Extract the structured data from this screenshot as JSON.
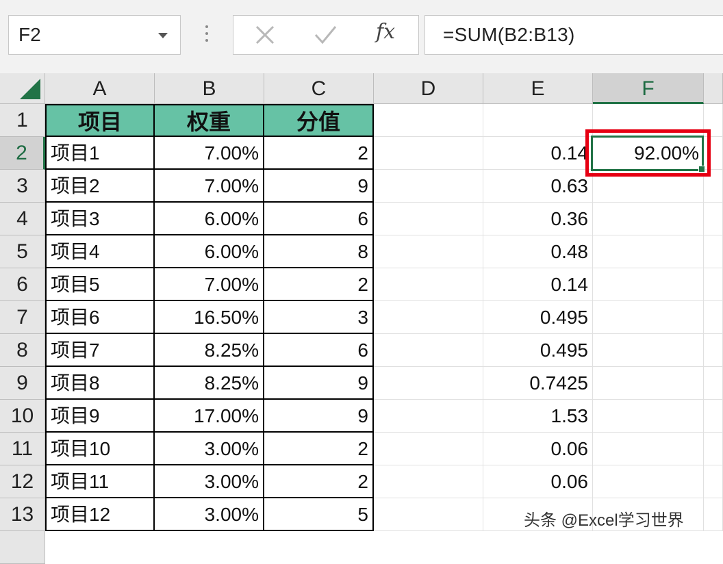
{
  "name_box": {
    "value": "F2"
  },
  "formula_bar": {
    "cancel_icon": "x-icon",
    "enter_icon": "check-icon",
    "fx_label": "fx",
    "formula": "=SUM(B2:B13)"
  },
  "columns": [
    "A",
    "B",
    "C",
    "D",
    "E",
    "F"
  ],
  "selected_column": "F",
  "rows": [
    "1",
    "2",
    "3",
    "4",
    "5",
    "6",
    "7",
    "8",
    "9",
    "10",
    "11",
    "12",
    "13"
  ],
  "selected_row": "2",
  "header_fill": "#66c2a5",
  "selection_color": "#217346",
  "highlight_color": "#e60012",
  "table": {
    "headers": [
      "项目",
      "权重",
      "分值"
    ],
    "rows": [
      [
        "项目1",
        "7.00%",
        "2"
      ],
      [
        "项目2",
        "7.00%",
        "9"
      ],
      [
        "项目3",
        "6.00%",
        "6"
      ],
      [
        "项目4",
        "6.00%",
        "8"
      ],
      [
        "项目5",
        "7.00%",
        "2"
      ],
      [
        "项目6",
        "16.50%",
        "3"
      ],
      [
        "项目7",
        "8.25%",
        "6"
      ],
      [
        "项目8",
        "8.25%",
        "9"
      ],
      [
        "项目9",
        "17.00%",
        "9"
      ],
      [
        "项目10",
        "3.00%",
        "2"
      ],
      [
        "项目11",
        "3.00%",
        "2"
      ],
      [
        "项目12",
        "3.00%",
        "5"
      ]
    ]
  },
  "column_e": [
    "0.14",
    "0.63",
    "0.36",
    "0.48",
    "0.14",
    "0.495",
    "0.495",
    "0.7425",
    "1.53",
    "0.06",
    "0.06",
    ""
  ],
  "column_f": {
    "F2": "92.00%"
  },
  "watermark": "头条 @Excel学习世界"
}
